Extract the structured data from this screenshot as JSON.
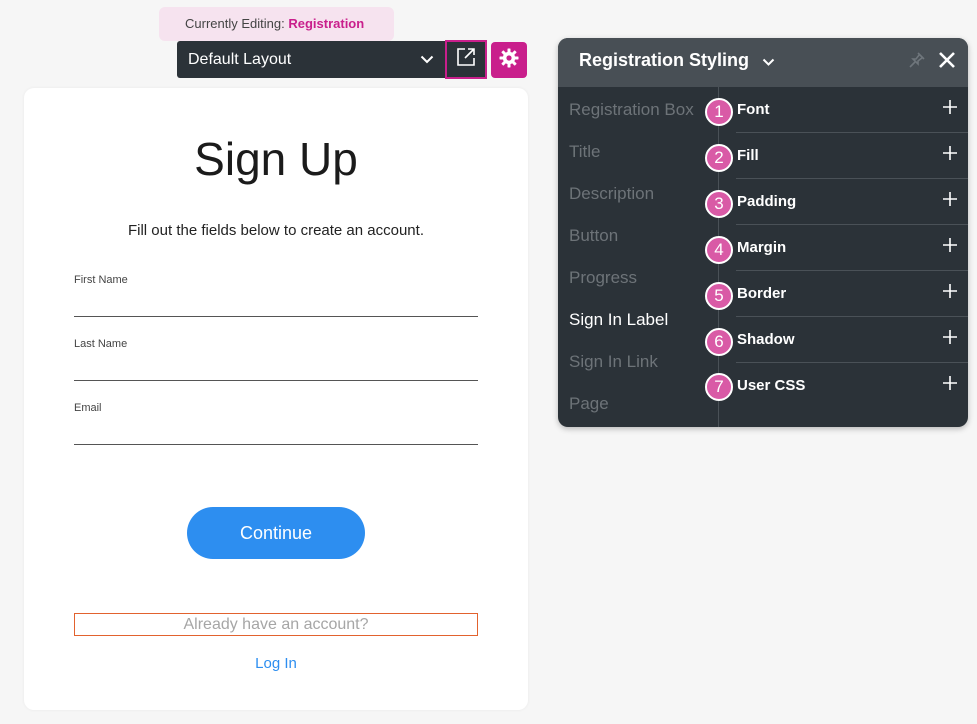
{
  "editing": {
    "prefix": "Currently Editing:",
    "target": "Registration"
  },
  "layout": {
    "selected": "Default Layout"
  },
  "card": {
    "title": "Sign Up",
    "description": "Fill out the fields below to create an account.",
    "fields": [
      {
        "label": "First Name",
        "value": ""
      },
      {
        "label": "Last Name",
        "value": ""
      },
      {
        "label": "Email",
        "value": ""
      }
    ],
    "continue_label": "Continue",
    "signin_label": "Already have an account?",
    "login_link": "Log In"
  },
  "panel": {
    "title": "Registration Styling",
    "elements": [
      {
        "label": "Registration Box",
        "active": false
      },
      {
        "label": "Title",
        "active": false
      },
      {
        "label": "Description",
        "active": false
      },
      {
        "label": "Button",
        "active": false
      },
      {
        "label": "Progress",
        "active": false
      },
      {
        "label": "Sign In Label",
        "active": true
      },
      {
        "label": "Sign In Link",
        "active": false
      },
      {
        "label": "Page",
        "active": false
      }
    ],
    "properties": [
      {
        "label": "Font",
        "badge": "1"
      },
      {
        "label": "Fill",
        "badge": "2"
      },
      {
        "label": "Padding",
        "badge": "3"
      },
      {
        "label": "Margin",
        "badge": "4"
      },
      {
        "label": "Border",
        "badge": "5"
      },
      {
        "label": "Shadow",
        "badge": "6"
      },
      {
        "label": "User CSS",
        "badge": "7"
      }
    ]
  },
  "colors": {
    "accent": "#c91f8c",
    "primary_button": "#2d8ef0",
    "panel_bg": "#2b3238",
    "badge": "#d95aa6",
    "signin_border": "#e2622e"
  },
  "icons": {
    "popout": "external-link-icon",
    "settings": "gear-icon",
    "pin": "pin-icon",
    "close": "close-icon",
    "expand": "plus-icon",
    "dropdown": "chevron-down-icon"
  }
}
